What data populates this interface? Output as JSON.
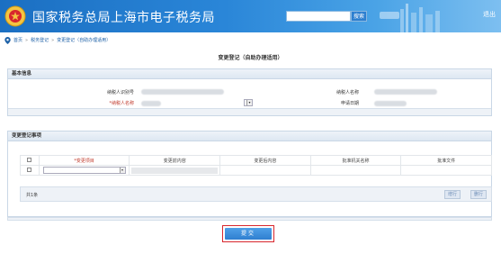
{
  "header": {
    "title": "国家税务总局上海市电子税务局",
    "search_label": "搜索",
    "exit_label": "退出",
    "logo_text": "中国税务"
  },
  "breadcrumb": {
    "items": [
      "首页",
      "税务登记",
      "变更登记（自助办理适用）"
    ],
    "separator": "»"
  },
  "page_title": "变更登记（自助办理适用）",
  "basic_info": {
    "heading": "基本信息",
    "fields": [
      {
        "label": "纳税人识别号"
      },
      {
        "label": "纳税人名称"
      },
      {
        "label": "*纳税人名称"
      },
      {
        "label": "申请日期"
      }
    ]
  },
  "change_items": {
    "heading": "变更登记事项",
    "columns": [
      "*变更项目",
      "变更前内容",
      "变更后内容",
      "批准机关名称",
      "批准文件"
    ],
    "footer": {
      "count_label": "共1条",
      "btn1": "增行",
      "btn2": "删行"
    }
  },
  "submit_label": "提交",
  "colors": {
    "header_blue": "#1b6fc2",
    "required_red": "#c0392b",
    "submit_highlight": "#d8262d"
  }
}
